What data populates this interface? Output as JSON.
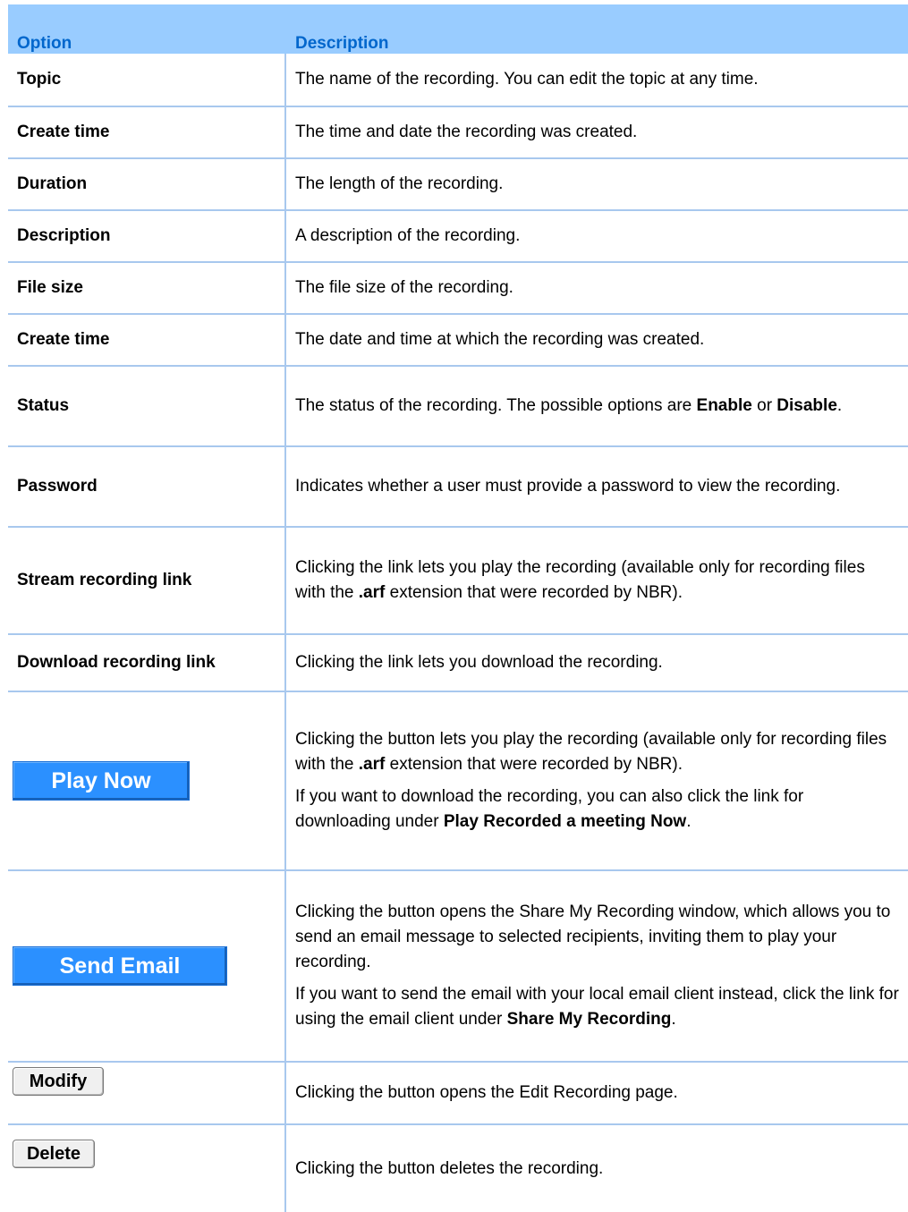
{
  "header": {
    "option": "Option",
    "description": "Description"
  },
  "rows": [
    {
      "option": "Topic",
      "description": [
        "The name of the recording. You can edit the topic at any time."
      ]
    },
    {
      "option": "Create time",
      "description": [
        "The time and date the recording was created."
      ]
    },
    {
      "option": "Duration",
      "description": [
        "The length of the recording."
      ]
    },
    {
      "option": "Description",
      "description": [
        "A description of the recording."
      ]
    },
    {
      "option": "File size",
      "description": [
        "The file size of the recording."
      ]
    },
    {
      "option": "Create time",
      "description": [
        "The date and time at which the recording was created."
      ]
    },
    {
      "option": "Status",
      "description_parts": [
        "The status of the recording. The possible options are ",
        "Enable",
        " or ",
        "Disable",
        "."
      ]
    },
    {
      "option": "Password",
      "description": [
        "Indicates whether a user must provide a password to view the recording."
      ]
    },
    {
      "option": "Stream recording link",
      "description_parts": [
        "Clicking the link lets you play the recording (available only for recording files with the ",
        ".arf",
        " extension that were recorded by NBR)."
      ]
    },
    {
      "option": "Download recording link",
      "description": [
        "Clicking the link lets you download the recording."
      ]
    },
    {
      "button": "Play Now",
      "p1_parts": [
        "Clicking the button lets you play the recording (available only for recording files with the ",
        ".arf",
        " extension that were recorded by NBR)."
      ],
      "p2_parts": [
        "If you want to download the recording, you can also click the link for downloading under ",
        "Play Recorded a meeting Now",
        "."
      ]
    },
    {
      "button": "Send Email",
      "p1": "Clicking the button opens the Share My Recording window, which allows you to send an email message to selected recipients, inviting them to play your recording.",
      "p2_parts": [
        "If you want to send the email with your local email client instead, click the link for using the email client under ",
        "Share My Recording",
        "."
      ]
    },
    {
      "button": "Modify",
      "description": [
        "Clicking the button opens the Edit Recording page."
      ]
    },
    {
      "button": "Delete",
      "description": [
        "Clicking the button deletes the recording."
      ]
    }
  ]
}
